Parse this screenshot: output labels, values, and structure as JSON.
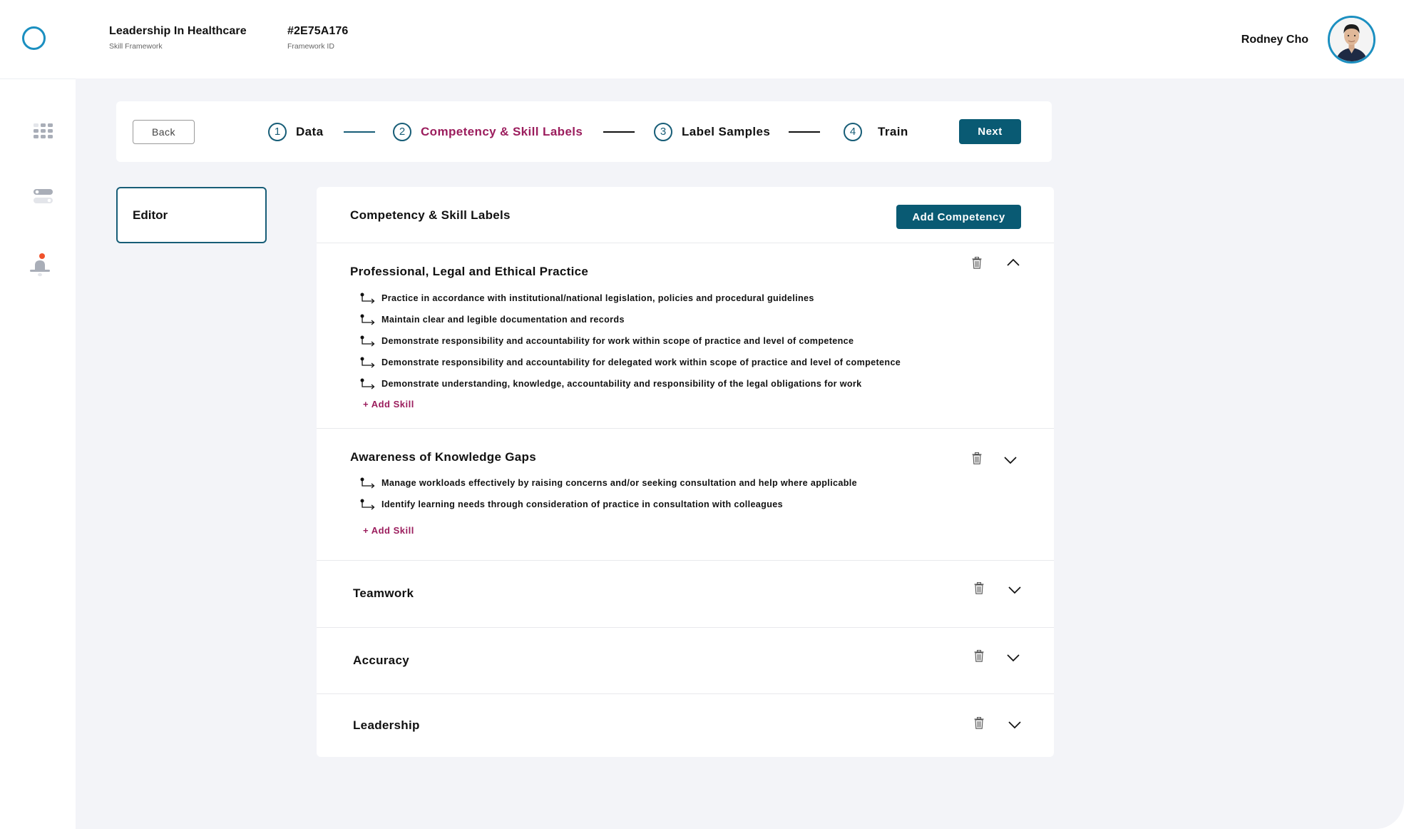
{
  "header": {
    "framework_name": "Leadership In Healthcare",
    "framework_name_label": "Skill Framework",
    "framework_id": "#2E75A176",
    "framework_id_label": "Framework ID",
    "user_name": "Rodney Cho"
  },
  "sidebar": {
    "items": [
      {
        "icon": "apps-grid-icon"
      },
      {
        "icon": "toggles-icon"
      },
      {
        "icon": "bell-icon",
        "has_notification": true
      }
    ]
  },
  "stepper": {
    "back_label": "Back",
    "next_label": "Next",
    "steps": [
      {
        "number": "1",
        "label": "Data",
        "state": "completed"
      },
      {
        "number": "2",
        "label": "Competency & Skill Labels",
        "state": "active"
      },
      {
        "number": "3",
        "label": "Label Samples",
        "state": "pending"
      },
      {
        "number": "4",
        "label": "Train",
        "state": "pending"
      }
    ]
  },
  "editor": {
    "label": "Editor"
  },
  "content": {
    "title": "Competency & Skill Labels",
    "add_competency_label": "Add Competency",
    "add_skill_label": "+ Add Skill",
    "competencies": [
      {
        "title": "Professional, Legal and Ethical Practice",
        "expanded": true,
        "skills": [
          "Practice in accordance with institutional/national legislation, policies and procedural guidelines",
          "Maintain clear and legible documentation and records",
          "Demonstrate responsibility and accountability for work within scope of practice and level of competence",
          "Demonstrate responsibility and accountability for delegated work within scope of practice and level of competence",
          "Demonstrate understanding, knowledge, accountability and responsibility of the legal obligations for work"
        ]
      },
      {
        "title": "Awareness of Knowledge Gaps",
        "expanded": true,
        "skills": [
          "Manage workloads effectively by raising concerns and/or seeking consultation and help where applicable",
          "Identify learning needs through consideration of practice in consultation with colleagues"
        ]
      },
      {
        "title": "Teamwork",
        "expanded": false,
        "skills": []
      },
      {
        "title": "Accuracy",
        "expanded": false,
        "skills": []
      },
      {
        "title": "Leadership",
        "expanded": false,
        "skills": []
      }
    ]
  },
  "colors": {
    "primary": "#095a73",
    "accent": "#9b1d5d",
    "logo": "#1b8fc0",
    "notification": "#f0522b",
    "background": "#f3f4f8"
  }
}
